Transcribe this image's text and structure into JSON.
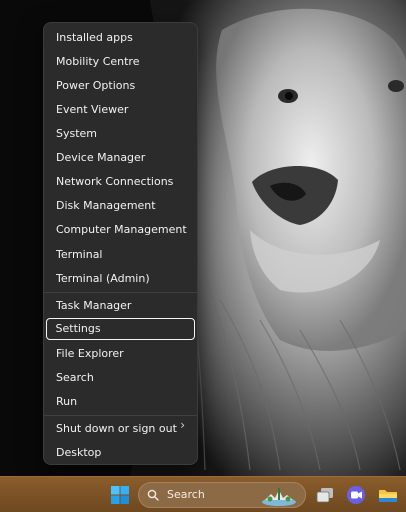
{
  "menu": {
    "items": [
      {
        "label": "Installed apps"
      },
      {
        "label": "Mobility Centre"
      },
      {
        "label": "Power Options"
      },
      {
        "label": "Event Viewer"
      },
      {
        "label": "System"
      },
      {
        "label": "Device Manager"
      },
      {
        "label": "Network Connections"
      },
      {
        "label": "Disk Management"
      },
      {
        "label": "Computer Management"
      },
      {
        "label": "Terminal"
      },
      {
        "label": "Terminal (Admin)"
      },
      {
        "label": "Task Manager"
      },
      {
        "label": "Settings",
        "focused": true
      },
      {
        "label": "File Explorer"
      },
      {
        "label": "Search"
      },
      {
        "label": "Run"
      },
      {
        "label": "Shut down or sign out",
        "has_submenu": true
      },
      {
        "label": "Desktop"
      }
    ]
  },
  "taskbar": {
    "search_placeholder": "Search",
    "icons": [
      "windows-start-icon",
      "search-icon",
      "landscape-widget-icon",
      "task-view-icon",
      "teams-chat-icon",
      "file-explorer-icon"
    ],
    "accent_color": "#7a5226"
  },
  "colors": {
    "menu_background": "#2b2b2b",
    "menu_text": "#f2f2f2",
    "focus_outline": "#f5f5f5"
  }
}
